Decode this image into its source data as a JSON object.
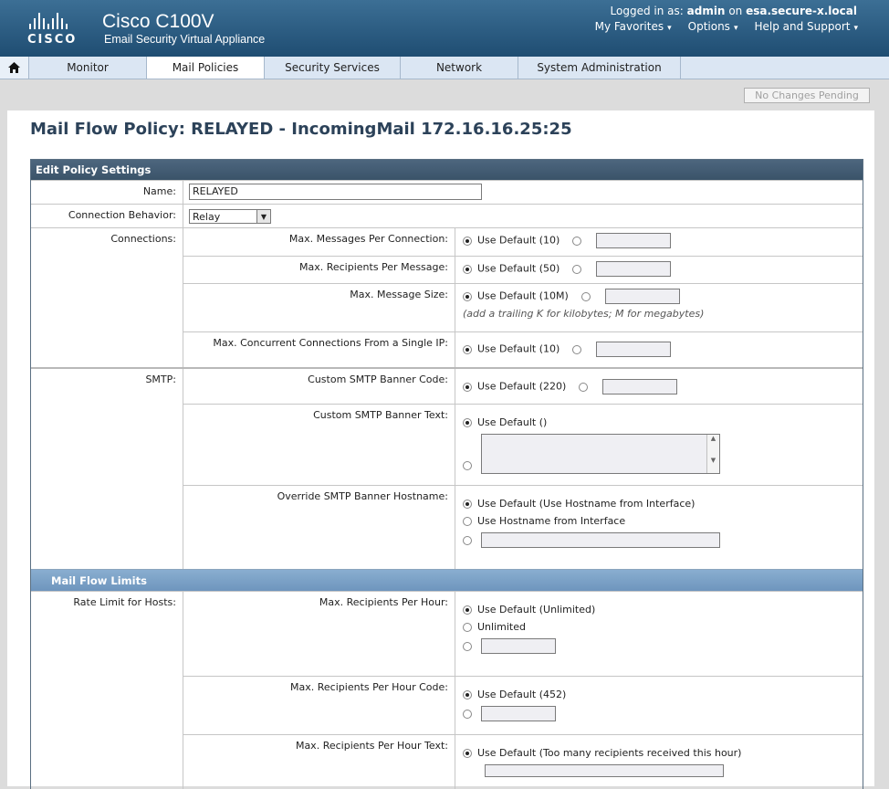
{
  "header": {
    "product": "Cisco C100V",
    "subtitle": "Email Security Virtual Appliance",
    "logo_word": "CISCO",
    "logged_in_prefix": "Logged in as:",
    "user": "admin",
    "on_word": "on",
    "host": "esa.secure-x.local",
    "menu": [
      "My Favorites",
      "Options",
      "Help and Support"
    ]
  },
  "nav": {
    "home_icon": "home-icon",
    "tabs": [
      "Monitor",
      "Mail Policies",
      "Security Services",
      "Network",
      "System Administration"
    ],
    "active": "Mail Policies"
  },
  "pending_button": "No Changes Pending",
  "page_title": "Mail Flow Policy: RELAYED - IncomingMail 172.16.16.25:25",
  "panel_title": "Edit Policy Settings",
  "name_label": "Name:",
  "name_value": "RELAYED",
  "connection_behavior_label": "Connection Behavior:",
  "connection_behavior_value": "Relay",
  "connections": {
    "label": "Connections:",
    "max_messages": {
      "label": "Max. Messages Per Connection:",
      "default": "Use Default (10)"
    },
    "max_recipients": {
      "label": "Max. Recipients Per Message:",
      "default": "Use Default (50)"
    },
    "max_size": {
      "label": "Max. Message Size:",
      "default": "Use Default (10M)",
      "note": "(add a trailing K for kilobytes; M for megabytes)"
    },
    "max_concurrent": {
      "label": "Max. Concurrent Connections From a Single IP:",
      "default": "Use Default (10)"
    }
  },
  "smtp": {
    "label": "SMTP:",
    "banner_code": {
      "label": "Custom SMTP Banner Code:",
      "default": "Use Default (220)"
    },
    "banner_text": {
      "label": "Custom SMTP Banner Text:",
      "default": "Use Default ()"
    },
    "banner_hostname": {
      "label": "Override SMTP Banner Hostname:",
      "default": "Use Default (Use Hostname from Interface)",
      "option2": "Use Hostname from Interface"
    }
  },
  "mail_flow_limits": {
    "band": "Mail Flow Limits",
    "rate_label": "Rate Limit for Hosts:",
    "max_per_hour": {
      "label": "Max. Recipients Per Hour:",
      "default": "Use Default (Unlimited)",
      "option2": "Unlimited"
    },
    "max_per_hour_code": {
      "label": "Max. Recipients Per Hour Code:",
      "default": "Use Default (452)"
    },
    "max_per_hour_text": {
      "label": "Max. Recipients Per Hour Text:",
      "default": "Use Default (Too many recipients received this hour)"
    }
  }
}
